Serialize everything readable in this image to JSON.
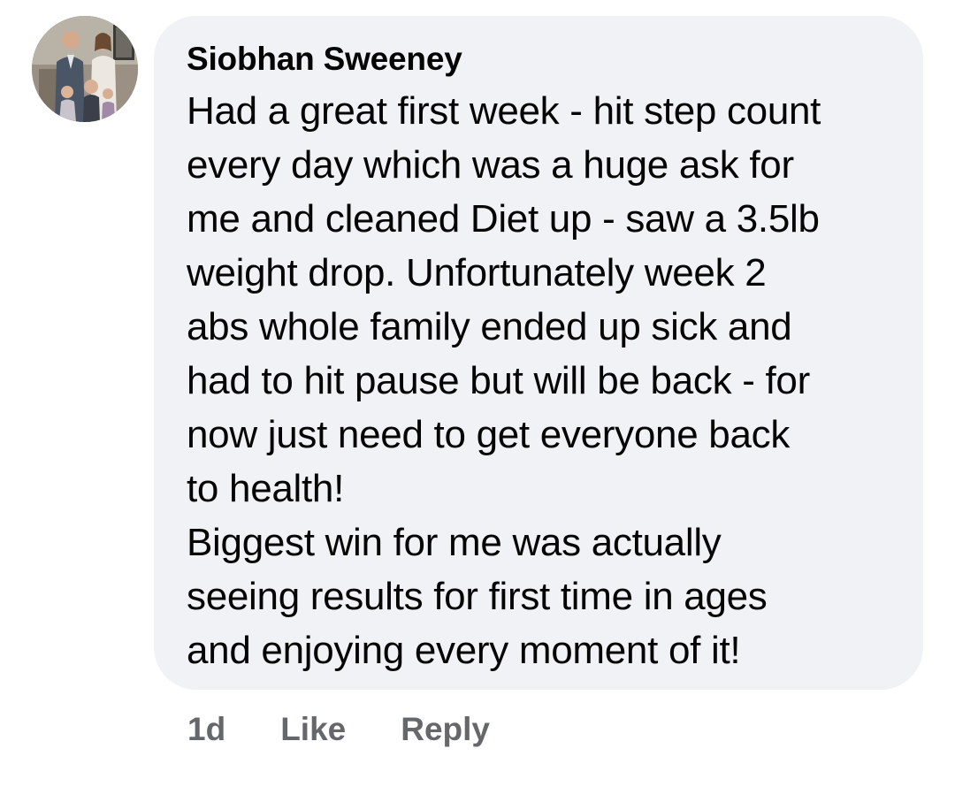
{
  "comment": {
    "author": "Siobhan Sweeney",
    "avatar_icon": "profile-photo-avatar",
    "lines": [
      "Had a great first week - hit step count",
      "every day which was a huge ask for",
      "me and cleaned Diet up - saw a 3.5lb",
      "weight drop. Unfortunately week 2",
      "abs whole family ended up sick and",
      "had to hit pause but will be back - for",
      "now just need to get everyone back",
      "to health!",
      "Biggest win for me was actually",
      "seeing results for first time in ages",
      "and enjoying every moment of it!"
    ],
    "bubble_color": "#f0f2f5",
    "text_color": "#050505"
  },
  "actions": {
    "timestamp": "1d",
    "like_label": "Like",
    "reply_label": "Reply",
    "color": "#65676b"
  }
}
